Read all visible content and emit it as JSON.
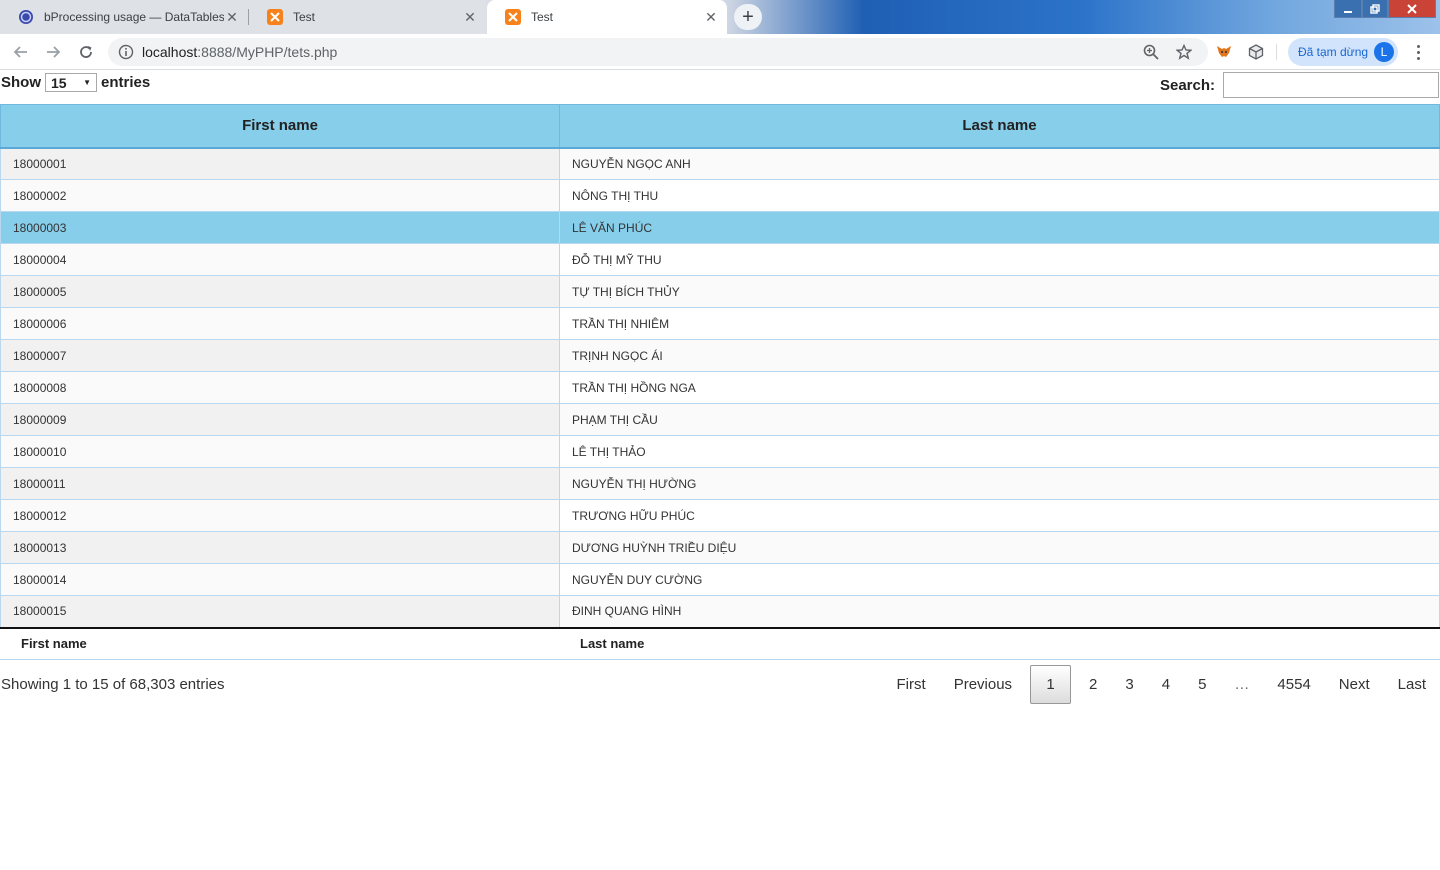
{
  "browser": {
    "tabs": [
      {
        "title": "bProcessing usage — DataTables",
        "active": false
      },
      {
        "title": "Test",
        "active": false
      },
      {
        "title": "Test",
        "active": true
      }
    ],
    "new_tab_label": "+",
    "url_host": "localhost",
    "url_path": ":8888/MyPHP/tets.php",
    "profile_label": "Đã tạm dừng",
    "profile_initial": "L"
  },
  "controls": {
    "show_label": "Show",
    "length_value": "15",
    "entries_label": "entries",
    "search_label": "Search:",
    "search_value": ""
  },
  "table": {
    "columns": [
      "First name",
      "Last name"
    ],
    "rows": [
      [
        "18000001",
        "NGUYỄN NGỌC ANH"
      ],
      [
        "18000002",
        "NÔNG THỊ THU"
      ],
      [
        "18000003",
        "LÊ VĂN PHÚC"
      ],
      [
        "18000004",
        "ĐỖ THỊ MỸ THU"
      ],
      [
        "18000005",
        "TỰ THỊ BÍCH THỦY"
      ],
      [
        "18000006",
        "TRẦN THỊ NHIÊM"
      ],
      [
        "18000007",
        "TRỊNH NGỌC ÁI"
      ],
      [
        "18000008",
        "TRẦN THỊ HỒNG NGA"
      ],
      [
        "18000009",
        "PHẠM THỊ CẦU"
      ],
      [
        "18000010",
        "LÊ THỊ THẢO"
      ],
      [
        "18000011",
        "NGUYỄN THỊ HƯỜNG"
      ],
      [
        "18000012",
        "TRƯƠNG HỮU PHÚC"
      ],
      [
        "18000013",
        "DƯƠNG HUỲNH TRIỀU DIỆU"
      ],
      [
        "18000014",
        "NGUYỄN DUY CƯỜNG"
      ],
      [
        "18000015",
        "ĐINH QUANG HÌNH"
      ]
    ],
    "selected_row_index": 2,
    "footer": [
      "First name",
      "Last name"
    ]
  },
  "info": "Showing 1 to 15 of 68,303 entries",
  "pagination": {
    "first": "First",
    "previous": "Previous",
    "pages": [
      "1",
      "2",
      "3",
      "4",
      "5"
    ],
    "current": "1",
    "ellipsis": "…",
    "last_page": "4554",
    "next": "Next",
    "last": "Last"
  },
  "colors": {
    "header_bg": "#87ceeb",
    "selected_bg": "#87ceeb",
    "profile_accent": "#1a73e8"
  }
}
